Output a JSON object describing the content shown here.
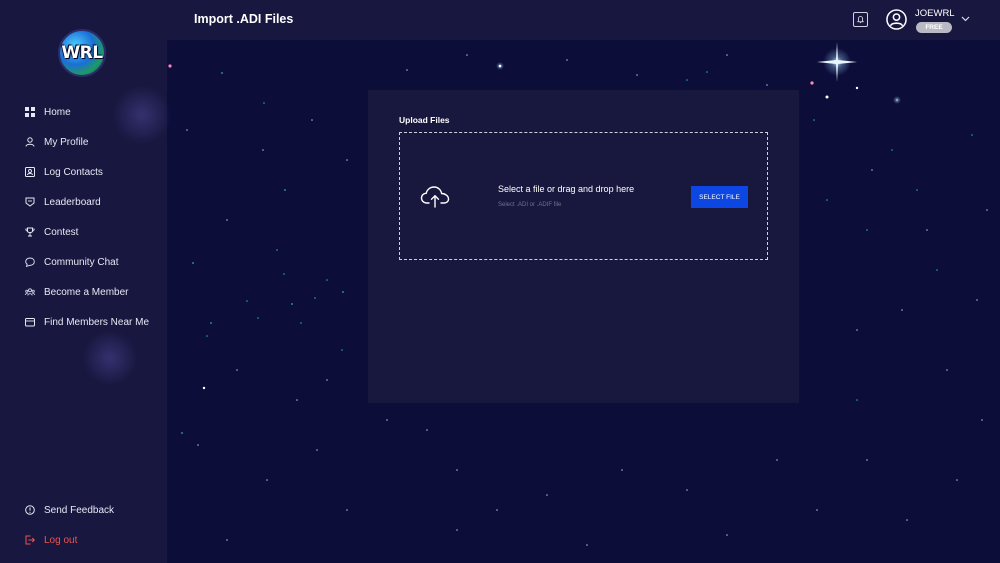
{
  "brand": {
    "logo_text": "WRL"
  },
  "header": {
    "title": "Import .ADI Files",
    "username": "JOEWRL",
    "plan_badge": "FREE"
  },
  "sidebar": {
    "items": [
      {
        "label": "Home",
        "icon": "grid-icon"
      },
      {
        "label": "My Profile",
        "icon": "user-icon"
      },
      {
        "label": "Log Contacts",
        "icon": "contact-card-icon"
      },
      {
        "label": "Leaderboard",
        "icon": "leaderboard-icon"
      },
      {
        "label": "Contest",
        "icon": "trophy-icon"
      },
      {
        "label": "Community Chat",
        "icon": "chat-icon"
      },
      {
        "label": "Become a Member",
        "icon": "members-icon"
      },
      {
        "label": "Find Members Near Me",
        "icon": "folder-icon"
      }
    ],
    "bottom_items": [
      {
        "label": "Send Feedback",
        "icon": "info-icon"
      },
      {
        "label": "Log out",
        "icon": "logout-icon"
      }
    ]
  },
  "upload": {
    "title": "Upload Files",
    "drop_text": "Select a file or drag and drop here",
    "hint": "Select .ADI or .ADIF file",
    "button_label": "SELECT FILE"
  },
  "colors": {
    "background": "#0d0d3a",
    "sidebar": "#17173f",
    "panel": "#18183e",
    "accent": "#0d47e3",
    "logout": "#f0524f"
  }
}
